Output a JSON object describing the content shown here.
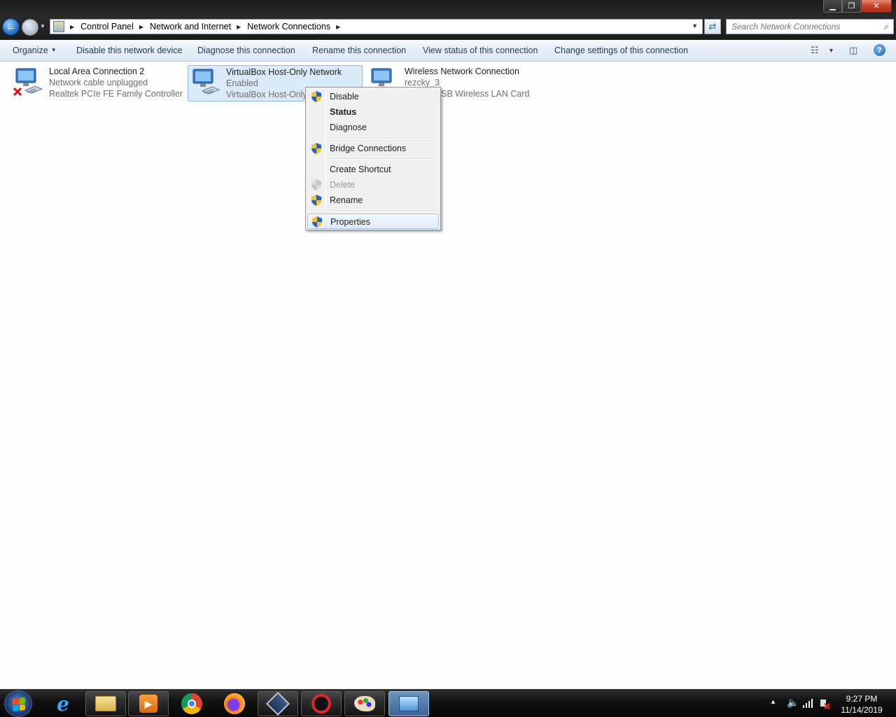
{
  "window": {
    "caption_minimize": "▁",
    "caption_restore": "❐",
    "caption_close": "✕"
  },
  "address_bar": {
    "breadcrumbs": [
      "Control Panel",
      "Network and Internet",
      "Network Connections"
    ],
    "search_placeholder": "Search Network Connections"
  },
  "command_bar": {
    "organize": "Organize",
    "disable_device": "Disable this network device",
    "diagnose": "Diagnose this connection",
    "rename": "Rename this connection",
    "view_status": "View status of this connection",
    "change_settings": "Change settings of this connection",
    "help": "?"
  },
  "connections": [
    {
      "name": "Local Area Connection 2",
      "status": "Network cable unplugged",
      "device": "Realtek PCIe FE Family Controller",
      "icon": "network-adapter-disconnected-icon"
    },
    {
      "name": "VirtualBox Host-Only Network",
      "status": "Enabled",
      "device": "VirtualBox Host-Only",
      "icon": "network-adapter-icon"
    },
    {
      "name": "Wireless Network Connection",
      "status": "rezcky_3",
      "device": "SB Wireless LAN Card",
      "icon": "wireless-adapter-icon"
    }
  ],
  "context_menu": {
    "items": [
      {
        "label": "Disable",
        "shield": true
      },
      {
        "label": "Status",
        "bold": true
      },
      {
        "label": "Diagnose"
      },
      {
        "label": "Bridge Connections",
        "shield": true
      },
      {
        "label": "Create Shortcut"
      },
      {
        "label": "Delete",
        "disabled": true,
        "shield": true
      },
      {
        "label": "Rename",
        "shield": true
      },
      {
        "label": "Properties",
        "shield": true,
        "highlighted": true
      }
    ]
  },
  "taskbar": {
    "pinned_apps": [
      "internet-explorer",
      "windows-explorer",
      "media-player",
      "chrome",
      "firefox",
      "virtualbox",
      "bandicam",
      "paint",
      "network-connections"
    ],
    "clock_time": "9:27 PM",
    "clock_date": "11/14/2019",
    "tray_icons": [
      "show-hidden-icons",
      "volume-icon",
      "network-signal-icon",
      "action-center-icon"
    ]
  },
  "colors": {
    "accent": "#3d6595",
    "selection": "#dbeaf9",
    "command_text": "#1e3957"
  }
}
